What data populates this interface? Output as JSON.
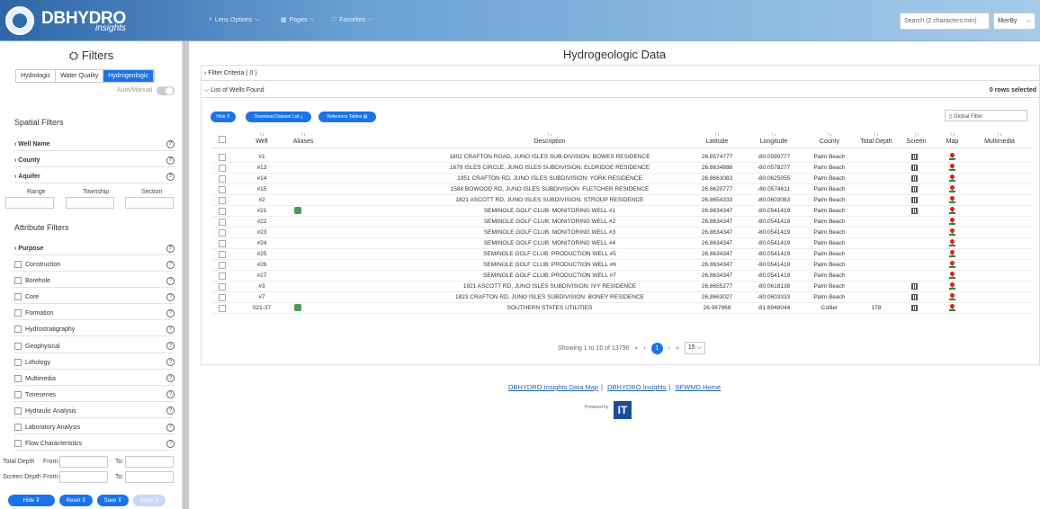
{
  "app": {
    "logo_text": "DBHYDRO",
    "logo_sub": "insights",
    "nav": [
      "Lens Options",
      "Pages",
      "Favorites"
    ],
    "search_placeholder": "Search (2 characters min)",
    "filterby": "filterBy"
  },
  "sidebar": {
    "title": "Filters",
    "tabs": [
      "Hydrologic",
      "Water Quality",
      "Hydrogeologic"
    ],
    "active_tab": "Hydrogeologic",
    "auto_manual": "Auto/Manual",
    "spatial_title": "Spatial Filters",
    "spatial": [
      "Well Name",
      "County",
      "Aquifer"
    ],
    "rts": [
      "Range",
      "Township",
      "Section"
    ],
    "attribute_title": "Attribute Filters",
    "purpose": "Purpose",
    "attributes": [
      "Construction",
      "Borehole",
      "Core",
      "Formation",
      "Hydrostratigraphy",
      "Geophysical",
      "Lithology",
      "Multimedia",
      "Timeseries",
      "Hydraulic Analysis",
      "Laboratory Analysis",
      "Flow Characteristics"
    ],
    "total_depth": "Total Depth",
    "screen_depth": "Screen Depth",
    "from": "From:",
    "to": "To:",
    "buttons": [
      "Hide ⊽",
      "Reset ⊽",
      "Save ⊽",
      "Apply ⊽"
    ]
  },
  "main": {
    "title": "Hydrogeologic Data",
    "filter_criteria": "Filter Criteria ( 0 )",
    "list_title": "List of Wells Found",
    "rows_selected": "0 rows selected",
    "btn_hide": "Hide ⊽",
    "btn_download": "Download Dataset List ⤓",
    "btn_ref": "Reference Tables ▤",
    "global_filter": "▯ Global Filter",
    "columns": [
      "Well",
      "Aliases",
      "Description",
      "Latitude",
      "Longitude",
      "County",
      "Total Depth",
      "Screen",
      "Map",
      "Multimedia"
    ],
    "sort_glyph": "↑↓",
    "rows": [
      {
        "well": "#1",
        "alias": false,
        "desc": "1802 CRAFTON ROAD, JUNO ISLES SUB-DIVISION: BOWES RESIDENCE",
        "lat": "26.8574777",
        "lon": "-80.0599777",
        "county": "Palm Beach",
        "depth": "",
        "screen": true
      },
      {
        "well": "#13",
        "alias": false,
        "desc": "1679 ISLES CIRCLE, JUNO ISLES SUBDIVISION: ELDRIDGE RESIDENCE",
        "lat": "26.8634888",
        "lon": "-80.0578277",
        "county": "Palm Beach",
        "depth": "",
        "screen": true
      },
      {
        "well": "#14",
        "alias": false,
        "desc": "1951 CRAFTON RD, JUNO ISLES SUBDIVISION: YORK RESIDENCE",
        "lat": "26.8663083",
        "lon": "-80.0625055",
        "county": "Palm Beach",
        "depth": "",
        "screen": true
      },
      {
        "well": "#15",
        "alias": false,
        "desc": "1588 BOWOOD RD, JUNO ISLES SUBDIVISION: FLETCHER RESIDENCE",
        "lat": "26.8620777",
        "lon": "-80.0574611",
        "county": "Palm Beach",
        "depth": "",
        "screen": true
      },
      {
        "well": "#2",
        "alias": false,
        "desc": "1821 ASCOTT RD, JUNO ISLES SUBDIVISION: STROUP RESIDENCE",
        "lat": "26.8654333",
        "lon": "-80.0603083",
        "county": "Palm Beach",
        "depth": "",
        "screen": true
      },
      {
        "well": "#21",
        "alias": true,
        "desc": "SEMINOLE GOLF CLUB: MONITORING WELL #1",
        "lat": "26.8634347",
        "lon": "-80.0541419",
        "county": "Palm Beach",
        "depth": "",
        "screen": true
      },
      {
        "well": "#22",
        "alias": false,
        "desc": "SEMINOLE GOLF CLUB: MONITORING WELL #2",
        "lat": "26.8634347",
        "lon": "-80.0541419",
        "county": "Palm Beach",
        "depth": "",
        "screen": false
      },
      {
        "well": "#23",
        "alias": false,
        "desc": "SEMINOLE GOLF CLUB: MONITORING WELL #3",
        "lat": "26.8634347",
        "lon": "-80.0541419",
        "county": "Palm Beach",
        "depth": "",
        "screen": false
      },
      {
        "well": "#24",
        "alias": false,
        "desc": "SEMINOLE GOLF CLUB: MONITORING WELL #4",
        "lat": "26.8634347",
        "lon": "-80.0541419",
        "county": "Palm Beach",
        "depth": "",
        "screen": false
      },
      {
        "well": "#25",
        "alias": false,
        "desc": "SEMINOLE GOLF CLUB: PRODUCTION WELL #5",
        "lat": "26.8634347",
        "lon": "-80.0541419",
        "county": "Palm Beach",
        "depth": "",
        "screen": false
      },
      {
        "well": "#26",
        "alias": false,
        "desc": "SEMINOLE GOLF CLUB: PRODUCTION WELL #6",
        "lat": "26.8634347",
        "lon": "-80.0541419",
        "county": "Palm Beach",
        "depth": "",
        "screen": false
      },
      {
        "well": "#27",
        "alias": false,
        "desc": "SEMINOLE GOLF CLUB: PRODUCTION WELL #7",
        "lat": "26.8634347",
        "lon": "-80.0541419",
        "county": "Palm Beach",
        "depth": "",
        "screen": false
      },
      {
        "well": "#3",
        "alias": false,
        "desc": "1921 ASCOTT RD, JUNO ISLES SUBDIVISION: IVY RESIDENCE",
        "lat": "26.8655277",
        "lon": "-80.0618138",
        "county": "Palm Beach",
        "depth": "",
        "screen": true
      },
      {
        "well": "#7",
        "alias": false,
        "desc": "1823 CRAFTON RD, JUNO ISLES SUBDIVISION: BONEY RESIDENCE",
        "lat": "26.8663027",
        "lon": "-80.0603333",
        "county": "Palm Beach",
        "depth": "",
        "screen": true
      },
      {
        "well": "021-37",
        "alias": true,
        "desc": "SOUTHERN STATES UTILITIES",
        "lat": "26.067868",
        "lon": "-81.6948044",
        "county": "Collier",
        "depth": "178",
        "screen": true
      }
    ],
    "pager_text": "Showing 1 to 15 of 13796",
    "pager_first": "«",
    "pager_prev": "‹",
    "pager_page": "1",
    "pager_next": "›",
    "pager_last": "»",
    "page_size": "15 ⌵"
  },
  "footer": {
    "links": [
      "DBHYDRO Insights Data Map",
      "DBHYDRO Insights",
      "SFWMD Home"
    ],
    "sep": "|",
    "powered": "Powered by",
    "it": "IT"
  }
}
